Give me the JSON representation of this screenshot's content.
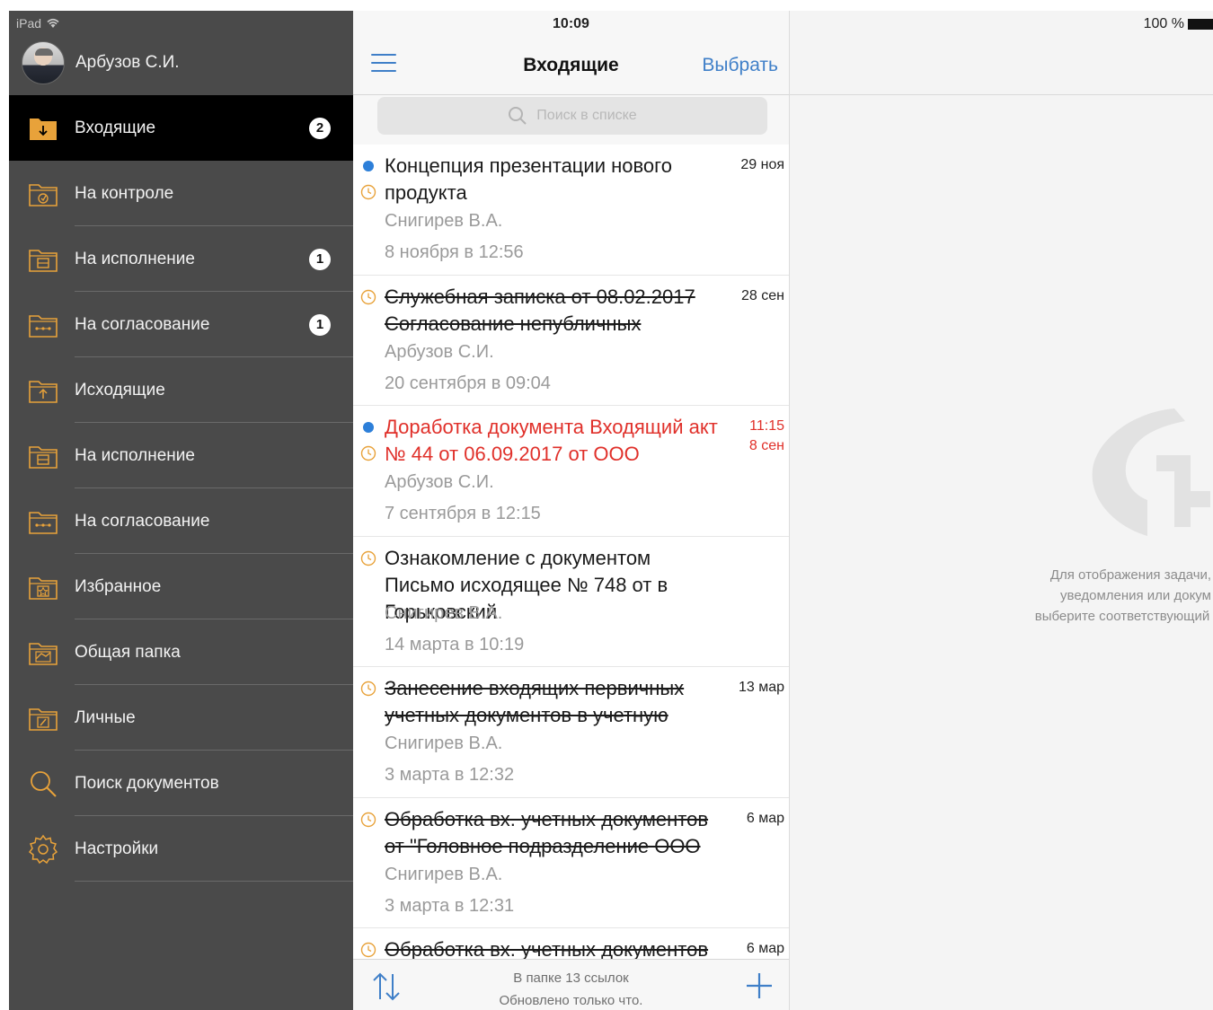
{
  "status_bar": {
    "device": "iPad",
    "time": "10:09",
    "battery": "100 %"
  },
  "user": {
    "name": "Арбузов С.И."
  },
  "sidebar": {
    "items": [
      {
        "label": "Входящие",
        "badge": "2",
        "icon": "inbox-folder-icon",
        "active": true
      },
      {
        "label": "На контроле",
        "badge": "",
        "icon": "control-folder-icon"
      },
      {
        "label": "На исполнение",
        "badge": "1",
        "icon": "execution-folder-icon"
      },
      {
        "label": "На согласование",
        "badge": "1",
        "icon": "approval-folder-icon"
      },
      {
        "label": "Исходящие",
        "badge": "",
        "icon": "outbox-folder-icon"
      },
      {
        "label": "На исполнение",
        "badge": "",
        "icon": "execution-folder-icon"
      },
      {
        "label": "На согласование",
        "badge": "",
        "icon": "approval-folder-icon"
      },
      {
        "label": "Избранное",
        "badge": "",
        "icon": "favorites-folder-icon"
      },
      {
        "label": "Общая папка",
        "badge": "",
        "icon": "shared-folder-icon"
      },
      {
        "label": "Личные",
        "badge": "",
        "icon": "personal-folder-icon"
      },
      {
        "label": "Поиск документов",
        "badge": "",
        "icon": "search-icon"
      },
      {
        "label": "Настройки",
        "badge": "",
        "icon": "gear-icon"
      }
    ]
  },
  "list": {
    "title": "Входящие",
    "select_label": "Выбрать",
    "search_placeholder": "Поиск в списке",
    "items": [
      {
        "title": "Концепция презентации нового продукта",
        "date": "29 ноя",
        "date2": "",
        "author": "Снигирев В.А.",
        "time": "8 ноября в 12:56",
        "unread": true,
        "struck": false,
        "red": false
      },
      {
        "title": "Служебная записка от 08.02.2017 Согласование непубличных",
        "date": "28 сен",
        "date2": "",
        "author": "Арбузов С.И.",
        "time": "20 сентября в 09:04",
        "unread": false,
        "struck": true,
        "red": false
      },
      {
        "title": "Доработка документа Входящий акт № 44 от 06.09.2017 от ООО",
        "date": "11:15",
        "date2": "8 сен",
        "author": "Арбузов С.И.",
        "time": "7 сентября в 12:15",
        "unread": true,
        "struck": false,
        "red": true
      },
      {
        "title": "Ознакомление с документом Письмо исходящее № 748 от  в Горьковский",
        "date": "",
        "date2": "",
        "author": "Снигирев В.А.",
        "time": "14 марта в 10:19",
        "unread": false,
        "struck": false,
        "red": false
      },
      {
        "title": "Занесение входящих первичных учетных документов в учетную",
        "date": "13 мар",
        "date2": "",
        "author": "Снигирев В.А.",
        "time": "3 марта в 12:32",
        "unread": false,
        "struck": true,
        "red": false
      },
      {
        "title": "Обработка вх. учетных документов от \"Головное подразделение ООО",
        "date": "6 мар",
        "date2": "",
        "author": "Снигирев В.А.",
        "time": "3 марта в 12:31",
        "unread": false,
        "struck": true,
        "red": false
      },
      {
        "title": "Обработка вх. учетных документов",
        "date": "6 мар",
        "date2": "",
        "author": "",
        "time": "",
        "unread": false,
        "struck": true,
        "red": false
      }
    ],
    "footer_line1": "В папке 13 ссылок",
    "footer_line2": "Обновлено только что."
  },
  "detail": {
    "hint_line1": "Для отображения задачи, з",
    "hint_line2": "уведомления или докум",
    "hint_line3": "выберите соответствующий объ"
  },
  "colors": {
    "accent": "#3f7fc8",
    "sidebar_bg": "#4a4a4a",
    "icon_orange": "#e8a23a",
    "unread_dot": "#2d7fd9",
    "urgent": "#e0302a"
  }
}
